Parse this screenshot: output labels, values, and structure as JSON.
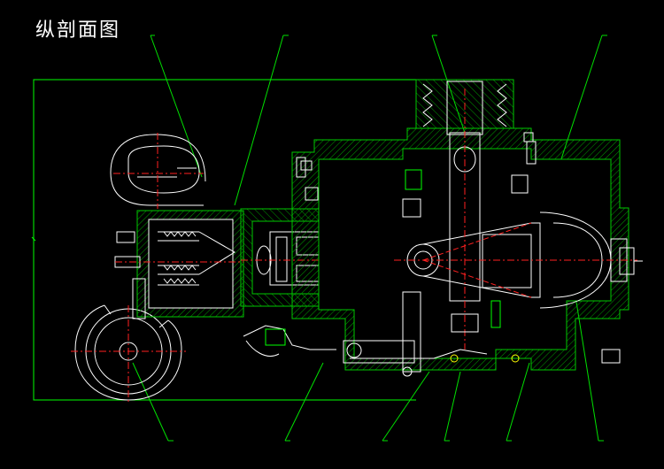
{
  "title": "纵剖面图",
  "colors": {
    "background": "#000000",
    "outline": "#ffffff",
    "section": "#00c800",
    "hatch": "#00a000",
    "centerline": "#ff2020",
    "leader": "#00e000",
    "frame": "#00ff00",
    "highlight": "#ffff00",
    "accent": "#00ffff"
  }
}
